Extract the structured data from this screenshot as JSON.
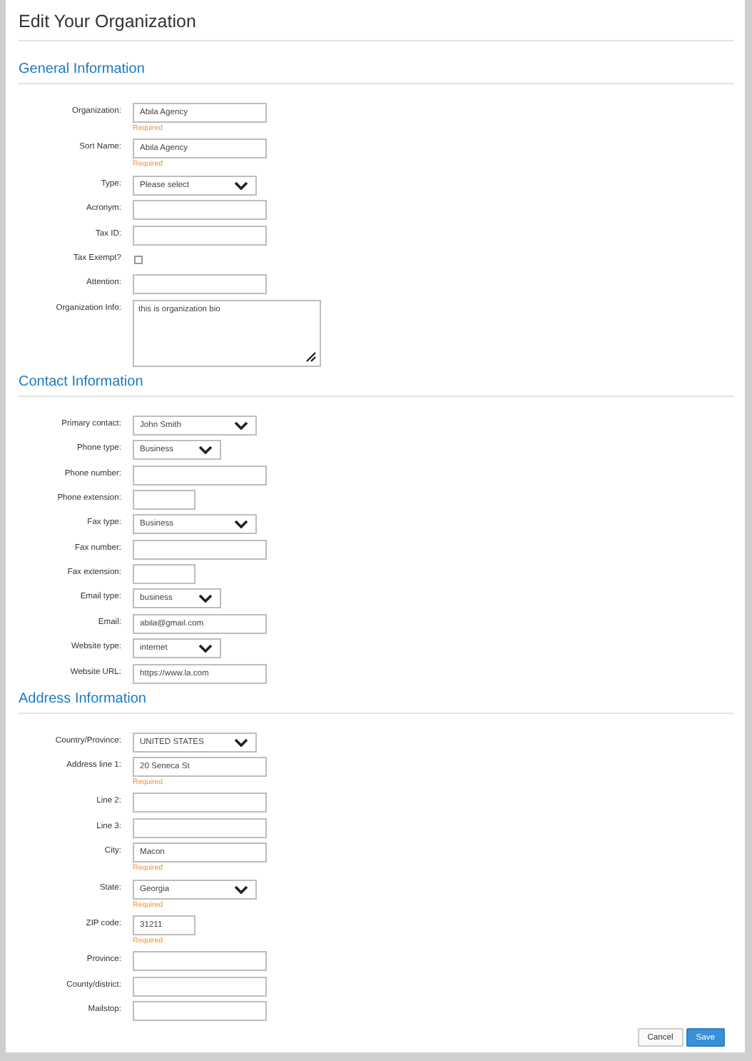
{
  "page_title": "Edit Your Organization",
  "sections": [
    {
      "title": "General Information",
      "fields": [
        {
          "label": "Organization:",
          "kind": "text",
          "value": "Abila Agency",
          "note": "Required"
        },
        {
          "label": "Sort Name:",
          "kind": "text",
          "value": "Abila Agency",
          "note": "Required"
        },
        {
          "label": "Type:",
          "kind": "select",
          "value": "Please select"
        },
        {
          "label": "Acronym:",
          "kind": "text"
        },
        {
          "label": "Tax ID:",
          "kind": "text"
        },
        {
          "label": "Tax Exempt?",
          "kind": "checkbox",
          "checked": false
        },
        {
          "label": "Attention:",
          "kind": "text"
        },
        {
          "label": "Organization Info:",
          "kind": "textarea",
          "value": "this is organization bio"
        }
      ]
    },
    {
      "title": "Contact Information",
      "fields": [
        {
          "label": "Primary contact:",
          "kind": "select",
          "value": "John Smith"
        },
        {
          "label": "Phone type:",
          "kind": "smallselect",
          "value": "Business"
        },
        {
          "label": "Phone number:",
          "kind": "text"
        },
        {
          "label": "Phone extension:",
          "kind": "shorttext"
        },
        {
          "label": "Fax type:",
          "kind": "select",
          "value": "Business"
        },
        {
          "label": "Fax number:",
          "kind": "text"
        },
        {
          "label": "Fax extension:",
          "kind": "shorttext"
        },
        {
          "label": "Email type:",
          "kind": "smallselect",
          "value": "business"
        },
        {
          "label": "Email:",
          "kind": "text",
          "value": "abila@gmail.com"
        },
        {
          "label": "Website type:",
          "kind": "smallselect",
          "value": "internet"
        },
        {
          "label": "Website URL:",
          "kind": "text",
          "value": "https://www.la.com"
        }
      ]
    },
    {
      "title": "Address Information",
      "fields": [
        {
          "label": "Country/Province:",
          "kind": "select",
          "value": "UNITED STATES"
        },
        {
          "label": "Address line 1:",
          "kind": "text",
          "value": "20 Seneca St",
          "note": "Required"
        },
        {
          "label": "Line 2:",
          "kind": "text"
        },
        {
          "label": "Line 3:",
          "kind": "text"
        },
        {
          "label": "City:",
          "kind": "text",
          "value": "Macon",
          "note": "Required"
        },
        {
          "label": "State:",
          "kind": "select",
          "value": "Georgia",
          "note": "Required"
        },
        {
          "label": "ZIP code:",
          "kind": "shorttext",
          "value": "31211",
          "note": "Required"
        },
        {
          "label": "Province:",
          "kind": "text"
        },
        {
          "label": "County/district:",
          "kind": "text"
        },
        {
          "label": "Mailstop:",
          "kind": "text"
        }
      ]
    }
  ],
  "buttons": [
    {
      "label": "Cancel",
      "kind": "secondary"
    },
    {
      "label": "Save",
      "kind": "primary"
    }
  ]
}
